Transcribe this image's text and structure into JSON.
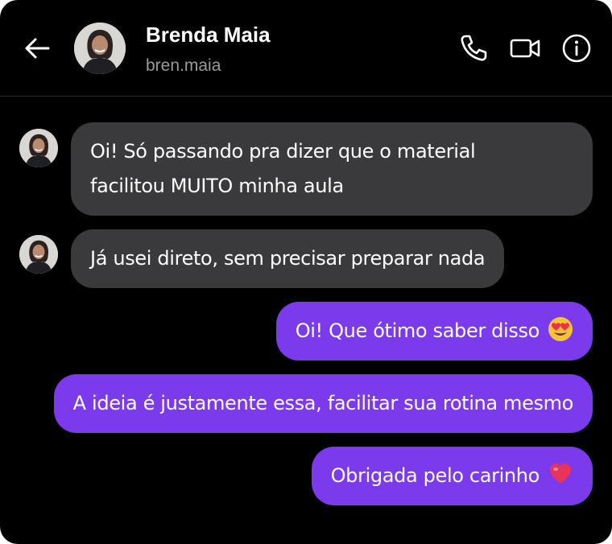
{
  "header": {
    "name": "Brenda Maia",
    "handle": "bren.maia",
    "icons": [
      "back-arrow-icon",
      "phone-icon",
      "video-camera-icon",
      "info-icon"
    ]
  },
  "messages": [
    {
      "from": "contact",
      "line1": "Oi! Só passando pra dizer que o material",
      "line2": "facilitou MUITO minha aula"
    },
    {
      "from": "contact",
      "text": "Já usei direto, sem precisar preparar nada"
    },
    {
      "from": "me",
      "text": "Oi! Que ótimo saber disso",
      "emoji": "heart-eyes-emoji"
    },
    {
      "from": "me",
      "text": "A ideia é justamente essa, facilitar sua rotina mesmo"
    },
    {
      "from": "me",
      "text": "Obrigada pelo carinho",
      "emoji": "heart-emoji"
    }
  ],
  "colors": {
    "background": "#000000",
    "incoming_bubble": "#3a3a3c",
    "outgoing_bubble": "#7c3aed",
    "text": "#ffffff",
    "secondary_text": "#9a9a9a"
  }
}
